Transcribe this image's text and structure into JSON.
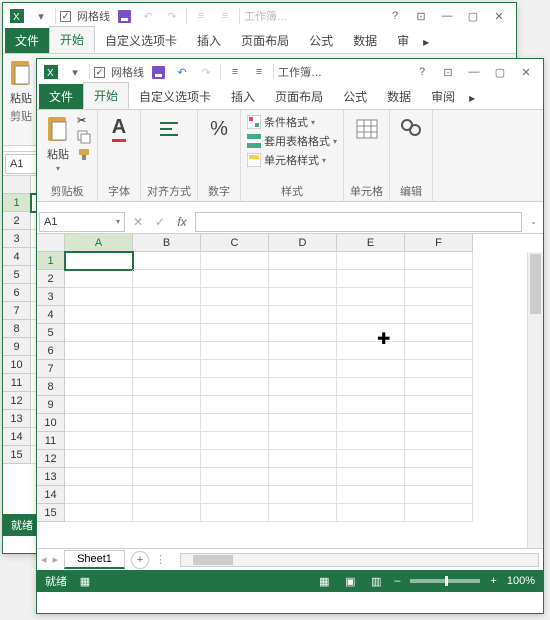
{
  "qat": {
    "gridlines": "网格线",
    "workbook": "工作簿…"
  },
  "tabs": {
    "file": "文件",
    "home": "开始",
    "custom": "自定义选项卡",
    "insert": "插入",
    "layout": "页面布局",
    "formula": "公式",
    "data": "数据",
    "review_a": "审",
    "review_b": "审阅"
  },
  "ribbon": {
    "clipboard": "剪贴板",
    "paste": "粘贴",
    "paste_short": "粘贴",
    "font": "字体",
    "align": "对齐方式",
    "number": "数字",
    "cond_format": "条件格式",
    "table_format": "套用表格格式",
    "cell_style": "单元格样式",
    "styles": "样式",
    "cells": "单元格",
    "editing": "编辑",
    "clip_short": "剪",
    "clip_med": "剪贴"
  },
  "namebox": "A1",
  "cols": [
    "A",
    "B",
    "C",
    "D",
    "E",
    "F"
  ],
  "rows_back": [
    1,
    2,
    3,
    4,
    5,
    6,
    7,
    8,
    9,
    10,
    11,
    12,
    13,
    14,
    15
  ],
  "rows_front": [
    1,
    2,
    3,
    4,
    5,
    6,
    7,
    8,
    9,
    10,
    11,
    12,
    13,
    14,
    15
  ],
  "sheet": "Sheet1",
  "status": {
    "ready": "就绪",
    "zoom": "100%"
  }
}
